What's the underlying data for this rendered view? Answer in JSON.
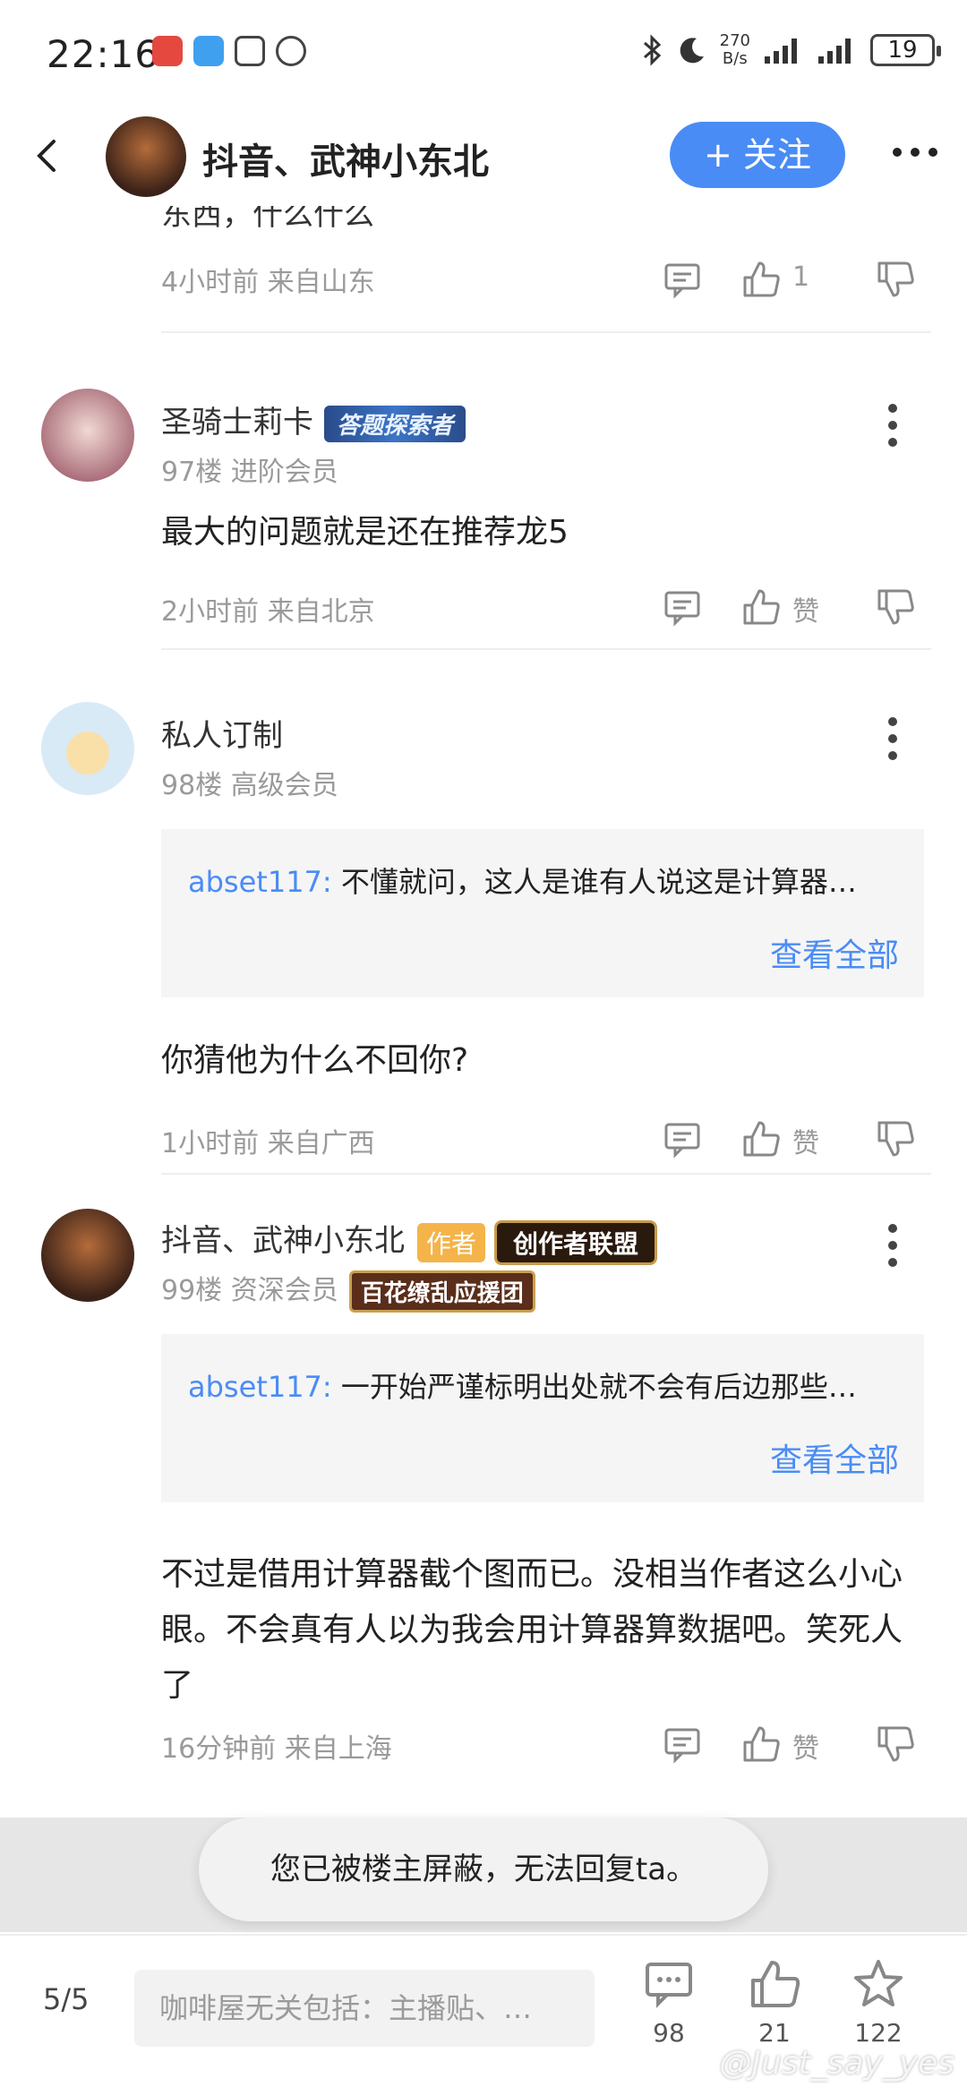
{
  "status_bar": {
    "time": "22:16",
    "net_speed_value": "270",
    "net_speed_unit": "B/s",
    "battery": "19"
  },
  "header": {
    "title": "抖音、武神小东北",
    "follow_label": "+ 关注"
  },
  "top_partial": {
    "cut_text": "东西，什么什么",
    "time": "4小时前 来自山东",
    "like_count": "1"
  },
  "comments": [
    {
      "name": "圣骑士莉卡",
      "badge": "答题探索者",
      "meta": "97楼 进阶会员",
      "text": "最大的问题就是还在推荐龙5",
      "time": "2小时前 来自北京",
      "like_label": "赞"
    },
    {
      "name": "私人订制",
      "meta": "98楼 高级会员",
      "quote_user": "abset117:",
      "quote_text": "不懂就问，这人是谁有人说这是计算器…",
      "quote_more": "查看全部",
      "text": "你猜他为什么不回你?",
      "time": "1小时前 来自广西",
      "like_label": "赞"
    },
    {
      "name": "抖音、武神小东北",
      "author_badge": "作者",
      "badge": "创作者联盟",
      "meta": "99楼 资深会员",
      "badge2": "百花缭乱应援团",
      "quote_user": "abset117:",
      "quote_text": "一开始严谨标明出处就不会有后边那些…",
      "quote_more": "查看全部",
      "text": "不过是借用计算器截个图而已。没相当作者这么小心眼。不会真有人以为我会用计算器算数据吧。笑死人了",
      "time": "16分钟前 来自上海",
      "like_label": "赞"
    }
  ],
  "toast": "您已被楼主屏蔽，无法回复ta。",
  "bottom_bar": {
    "page": "5/5",
    "input_placeholder": "咖啡屋无关包括：主播贴、…",
    "comment_count": "98",
    "like_count": "21",
    "star_count": "122",
    "watermark": "@Just_say_yes"
  },
  "colors": {
    "accent": "#4a8cf5",
    "author_badge": "#f4b44a",
    "meta_gray": "#9a9a9a"
  }
}
